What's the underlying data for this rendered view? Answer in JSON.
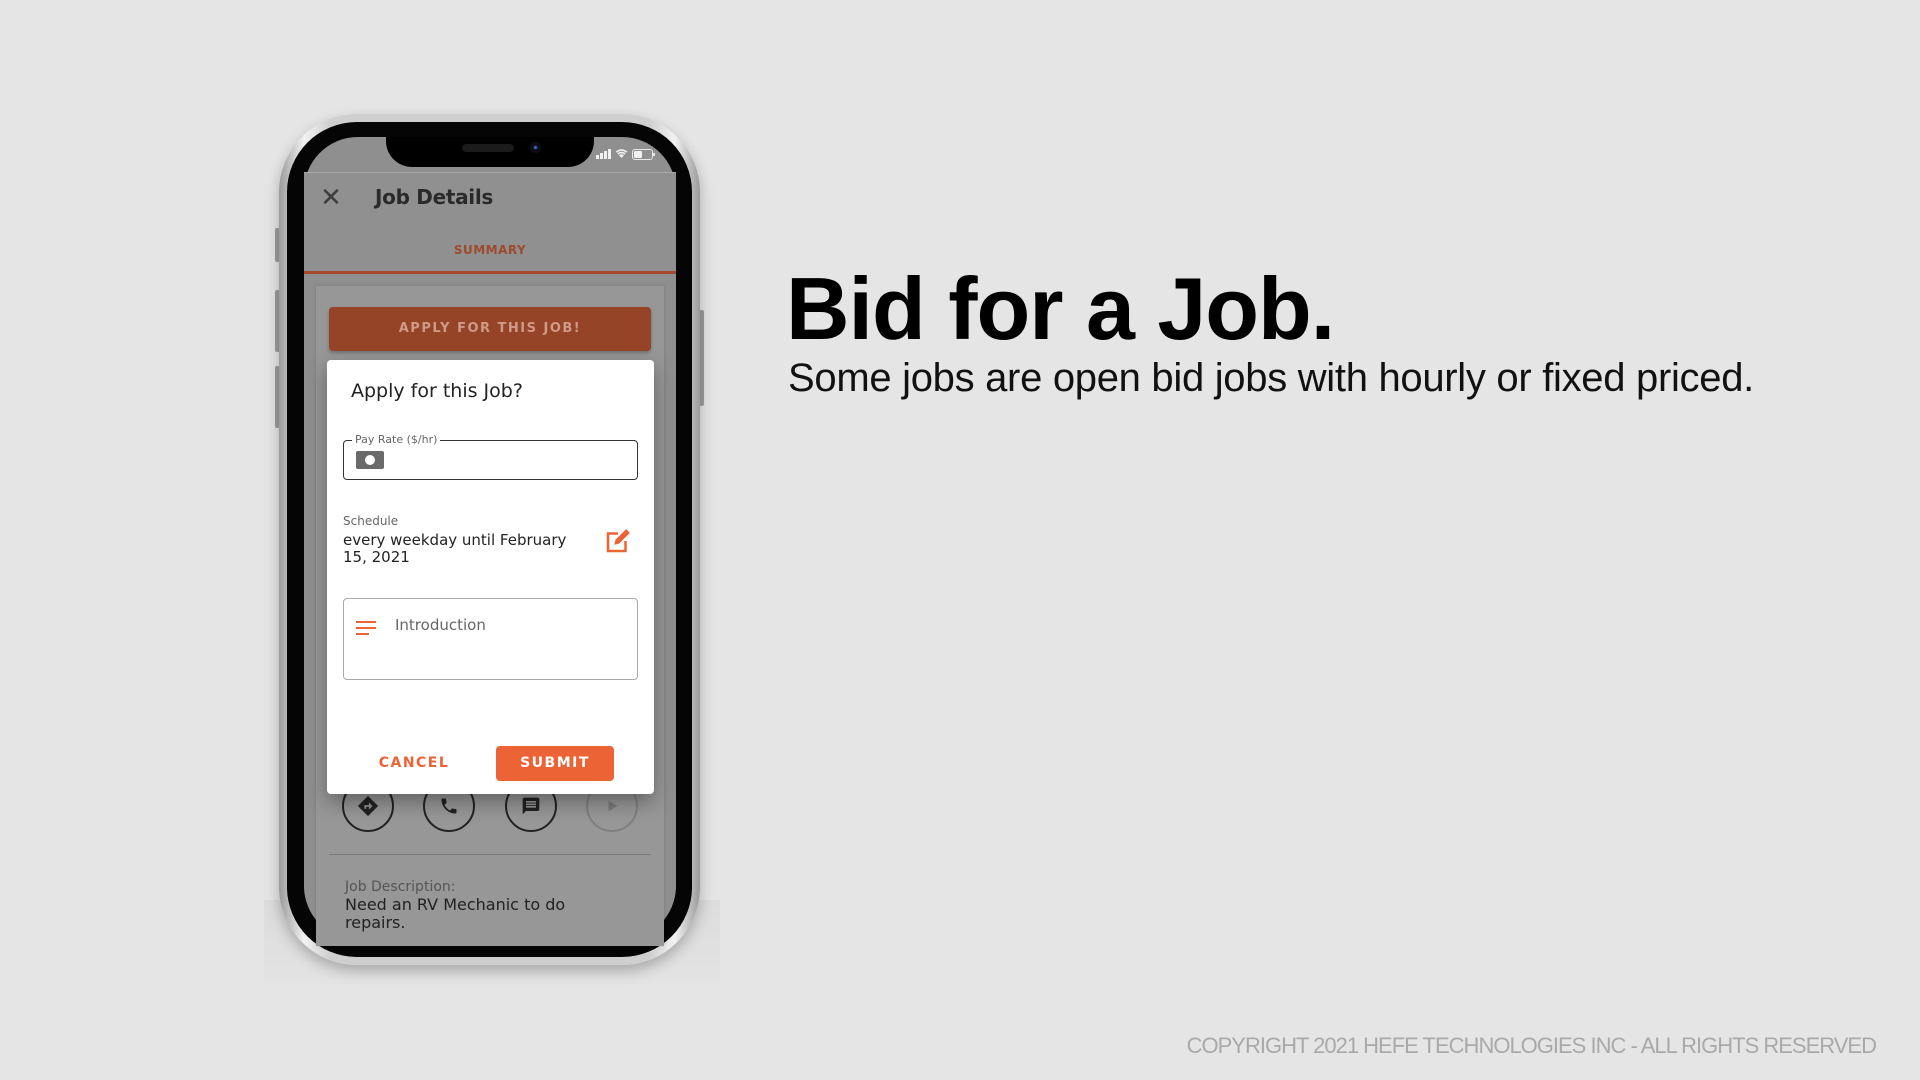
{
  "slide": {
    "headline": "Bid for a Job.",
    "subline": "Some jobs are open bid jobs with hourly or fixed priced.",
    "copyright": "COPYRIGHT 2021 HEFE TECHNOLOGIES INC - ALL RIGHTS RESERVED"
  },
  "phone": {
    "status_bar": {
      "icons": [
        "cellular-signal-icon",
        "wifi-icon",
        "battery-icon"
      ]
    },
    "header": {
      "close_icon": "✕",
      "title": "Job Details"
    },
    "tabs": [
      {
        "label": "SUMMARY",
        "active": true
      }
    ],
    "apply_button": "APPLY FOR THIS JOB!",
    "dialog": {
      "title": "Apply for this Job?",
      "pay_rate": {
        "label": "Pay Rate ($/hr)",
        "value": ""
      },
      "schedule": {
        "label": "Schedule",
        "value": "every weekday until February 15, 2021"
      },
      "introduction": {
        "placeholder": "Introduction",
        "value": ""
      },
      "cancel_label": "CANCEL",
      "submit_label": "SUBMIT"
    },
    "action_icons": [
      "directions-icon",
      "phone-icon",
      "message-icon",
      "play-icon"
    ],
    "job_description": {
      "label": "Job Description:",
      "text": "Need an RV Mechanic to do repairs."
    }
  },
  "colors": {
    "accent": "#ec6336",
    "accent_dimmed": "#954427",
    "background": "#e5e5e5"
  }
}
